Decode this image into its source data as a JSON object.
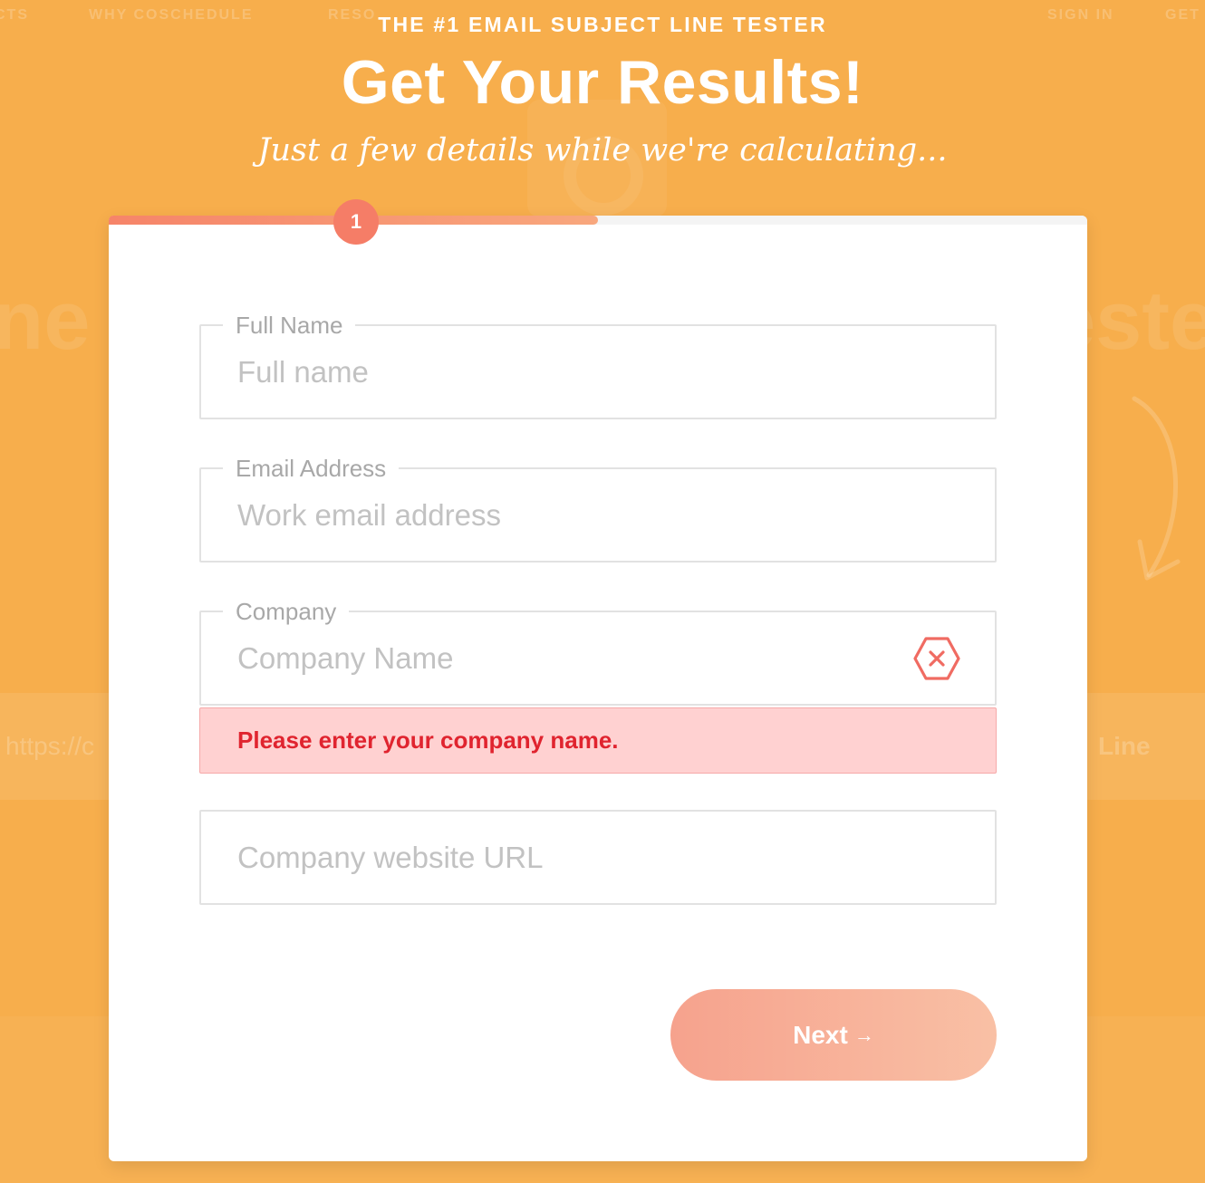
{
  "background": {
    "nav_items": [
      "CTS",
      "WHY COSCHEDULE",
      "RESO",
      "SIGN IN",
      "GET"
    ],
    "hero_left_fragment": "ne",
    "hero_right_fragment": "este",
    "url_fragment": "https://c",
    "line_fragment": "Line"
  },
  "header": {
    "eyebrow": "THE #1 EMAIL SUBJECT LINE TESTER",
    "title": "Get Your Results!",
    "subtitle": "Just a few details while we're calculating..."
  },
  "progress": {
    "step": "1",
    "fraction": 0.5
  },
  "form": {
    "full_name": {
      "label": "Full Name",
      "placeholder": "Full name",
      "value": ""
    },
    "email": {
      "label": "Email Address",
      "placeholder": "Work email address",
      "value": ""
    },
    "company": {
      "label": "Company",
      "placeholder": "Company Name",
      "value": "",
      "error_message": "Please enter your company name."
    },
    "website": {
      "placeholder": "Company website URL",
      "value": ""
    },
    "next_label": "Next",
    "next_arrow": "→"
  },
  "colors": {
    "page_bg": "#f7ae4c",
    "accent": "#f57d67",
    "error_text": "#e0242f",
    "error_bg": "#ffd1d1"
  }
}
